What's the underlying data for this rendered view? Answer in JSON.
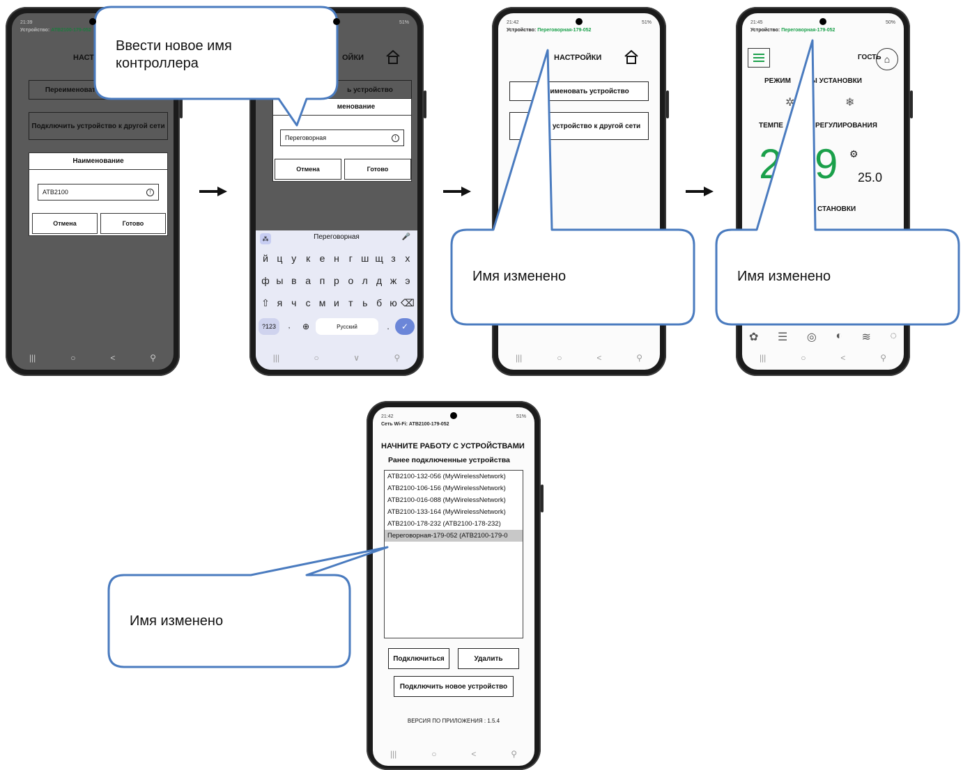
{
  "phone1": {
    "time": "21:39",
    "device_label": "Устройство:",
    "device_value": "АТВ2100-179-052",
    "title_partial": "НАСТР",
    "rename_button_partial": "Переименоват",
    "connect_button": "Подключить устройство к другой сети",
    "dialog_title": "Наименование",
    "input_value": "ATB2100",
    "cancel": "Отмена",
    "done": "Готово"
  },
  "phone2": {
    "battery": "51%",
    "title_partial": "ОЙКИ",
    "rename_button_partial": "ь устройство",
    "dialog_title_partial": "менование",
    "input_value": "Переговорная",
    "cancel": "Отмена",
    "done": "Готово",
    "suggestion": "Переговорная",
    "row1": [
      "й",
      "ц",
      "у",
      "к",
      "е",
      "н",
      "г",
      "ш",
      "щ",
      "з",
      "х"
    ],
    "row2": [
      "ф",
      "ы",
      "в",
      "а",
      "п",
      "р",
      "о",
      "л",
      "д",
      "ж",
      "э"
    ],
    "row3": [
      "я",
      "ч",
      "с",
      "м",
      "и",
      "т",
      "ь",
      "б",
      "ю"
    ],
    "numkey": "?123",
    "space_label": "Русский"
  },
  "phone3": {
    "time": "21:42",
    "battery": "51%",
    "device_label": "Устройство:",
    "device_value": "Переговорная-179-052",
    "title": "НАСТРОЙКИ",
    "rename_button_partial": "именовать устройство",
    "connect_button_partial": "ить устройство к другой сети"
  },
  "phone4": {
    "time": "21:45",
    "battery": "50%",
    "device_label": "Устройство:",
    "device_value": "Переговорная-179-052",
    "guest": "ГОСТЬ",
    "mode_partial_a": "РЕЖИМ",
    "mode_partial_b": "ТЫ УСТАНОВКИ",
    "temp_partial_a": "ТЕМПЕ",
    "temp_partial_b": "РЕГУЛИРОВАНИЯ",
    "big_digit_a": "2",
    "big_digit_b": "9",
    "setpoint": "25.0",
    "status_partial": "СТАНОВКИ"
  },
  "phone5": {
    "time": "21:42",
    "battery": "51%",
    "wifi_line": "Сеть Wi-Fi: АТВ2100-179-052",
    "title": "НАЧНИТЕ РАБОТУ С УСТРОЙСТВАМИ",
    "subtitle": "Ранее подключенные устройства",
    "devices": [
      "АТВ2100-132-056 (MyWirelessNetwork)",
      "АТВ2100-106-156 (MyWirelessNetwork)",
      "АТВ2100-016-088 (MyWirelessNetwork)",
      "АТВ2100-133-164 (MyWirelessNetwork)",
      "АТВ2100-178-232 (АТВ2100-178-232)",
      "Переговорная-179-052 (АТВ2100-179-0"
    ],
    "connect": "Подключиться",
    "delete": "Удалить",
    "connect_new": "Подключить новое устройство",
    "version": "ВЕРСИЯ ПО ПРИЛОЖЕНИЯ : 1.5.4"
  },
  "callouts": {
    "enter_name": "Ввести новое имя контроллера",
    "name_changed_1": "Имя изменено",
    "name_changed_2": "Имя изменено",
    "name_changed_3": "Имя изменено"
  },
  "colors": {
    "callout_border": "#4a7bbf",
    "accent_green": "#1aa04a"
  }
}
